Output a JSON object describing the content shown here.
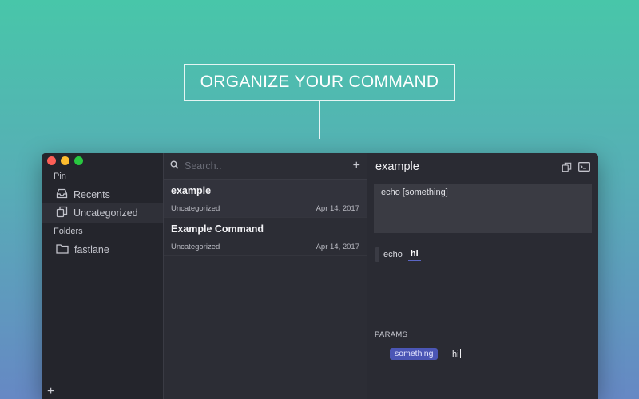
{
  "headline": "ORGANIZE YOUR COMMAND",
  "sidebar": {
    "pin_label": "Pin",
    "folders_label": "Folders",
    "pinned": [
      {
        "label": "Recents",
        "icon": "inbox-icon"
      },
      {
        "label": "Uncategorized",
        "icon": "copy-icon"
      }
    ],
    "folders": [
      {
        "label": "fastlane",
        "icon": "folder-icon"
      }
    ],
    "add_label": "+"
  },
  "search": {
    "placeholder": "Search.."
  },
  "list": {
    "add_label": "+",
    "items": [
      {
        "title": "example",
        "category": "Uncategorized",
        "date": "Apr 14, 2017"
      },
      {
        "title": "Example Command",
        "category": "Uncategorized",
        "date": "Apr 14, 2017"
      }
    ]
  },
  "detail": {
    "title": "example",
    "command": "echo [something]",
    "preview_line": "1",
    "preview_cmd": "echo",
    "preview_value": "hi",
    "params_label": "PARAMS",
    "param_name": "something",
    "param_value": "hi"
  },
  "colors": {
    "accent": "#4b56b5",
    "bg_top": "#48c6a9",
    "bg_bottom": "#6688c4",
    "window_bg": "#2a2b33"
  }
}
